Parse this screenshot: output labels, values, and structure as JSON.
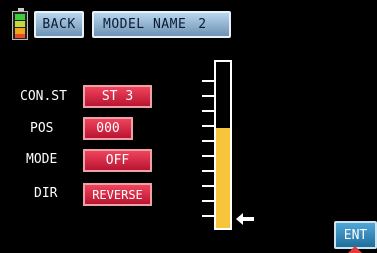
{
  "battery": {
    "icon": "battery-icon",
    "colors": [
      "#3ecb3e",
      "#c7d83a",
      "#f0a51e",
      "#e64b2a"
    ]
  },
  "header": {
    "back_label": "BACK",
    "model_label": "MODEL NAME",
    "model_number": "2"
  },
  "settings": {
    "con_st": {
      "label": "CON.ST",
      "value": "ST 3"
    },
    "pos": {
      "label": "POS",
      "value": "000"
    },
    "mode": {
      "label": "MODE",
      "value": "OFF"
    },
    "dir": {
      "label": "DIR",
      "value": "REVERSE"
    }
  },
  "gauge": {
    "level": 0.6,
    "fill_color": "#f7c53a",
    "marker": "left-arrow-icon"
  },
  "footer": {
    "ent_label": "ENT"
  },
  "colors": {
    "value_button": "#d9203f",
    "nav_button": "#8fb3d3",
    "ent_button": "#2f88bb"
  }
}
